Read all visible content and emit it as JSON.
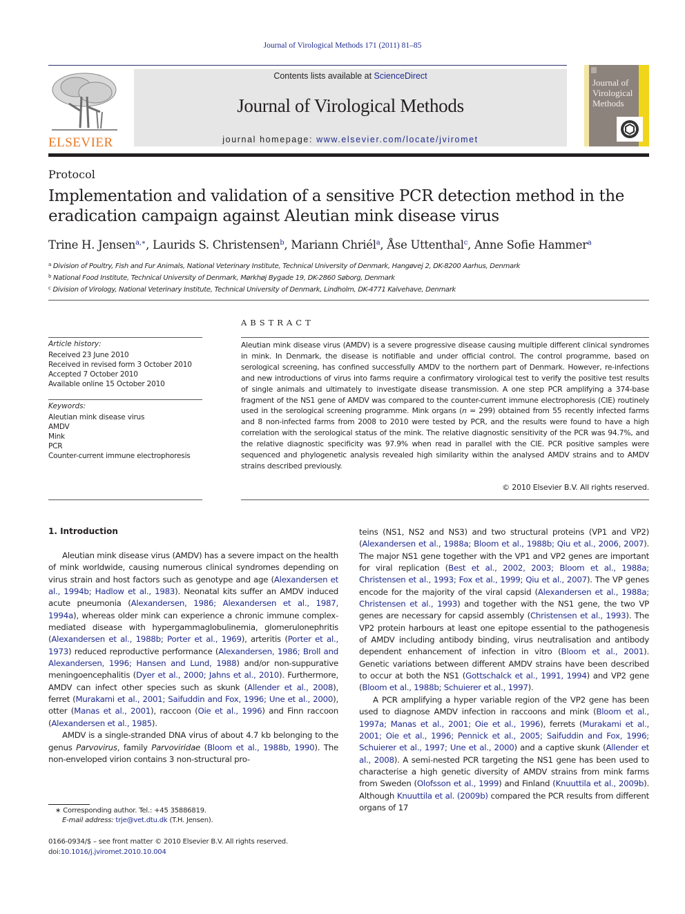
{
  "running_head": "Journal of Virological Methods 171 (2011) 81–85",
  "masthead": {
    "contents_prefix": "Contents lists available at ",
    "contents_link": "ScienceDirect",
    "journal_title": "Journal of Virological Methods",
    "homepage_prefix": "journal homepage: ",
    "homepage_link": "www.elsevier.com/locate/jviromet",
    "publisher_logo_text": "ELSEVIER",
    "cover_title": [
      "Journal of",
      "Virological",
      "Methods"
    ],
    "colors": {
      "publisher_orange": "#e87722",
      "link_blue": "#1f2b8e",
      "masthead_gray": "#e6e6e6",
      "cover_yellow": "#f1d51a"
    }
  },
  "article": {
    "section_type": "Protocol",
    "title": "Implementation and validation of a sensitive PCR detection method in the eradication campaign against Aleutian mink disease virus",
    "authors": [
      {
        "name": "Trine H. Jensen",
        "sup": "a,∗"
      },
      {
        "name": "Laurids S. Christensen",
        "sup": "b"
      },
      {
        "name": "Mariann Chriél",
        "sup": "a"
      },
      {
        "name": "Åse Uttenthal",
        "sup": "c"
      },
      {
        "name": "Anne Sofie Hammer",
        "sup": "a"
      }
    ],
    "affiliations": [
      {
        "key": "a",
        "text": "Division of Poultry, Fish and Fur Animals, National Veterinary Institute, Technical University of Denmark, Hangøvej 2, DK-8200 Aarhus, Denmark"
      },
      {
        "key": "b",
        "text": "National Food Institute, Technical University of Denmark, Mørkhøj Bygade 19, DK-2860 Søborg, Denmark"
      },
      {
        "key": "c",
        "text": "Division of Virology, National Veterinary Institute, Technical University of Denmark, Lindholm, DK-4771 Kalvehave, Denmark"
      }
    ]
  },
  "article_info": {
    "history_label": "Article history:",
    "history": [
      "Received 23 June 2010",
      "Received in revised form 3 October 2010",
      "Accepted 7 October 2010",
      "Available online 15 October 2010"
    ],
    "keywords_label": "Keywords:",
    "keywords": [
      "Aleutian mink disease virus",
      "AMDV",
      "Mink",
      "PCR",
      "Counter-current immune electrophoresis"
    ]
  },
  "abstract": {
    "heading": "ABSTRACT",
    "segments": [
      {
        "t": "Aleutian mink disease virus (AMDV) is a severe progressive disease causing multiple different clinical syndromes in mink. In Denmark, the disease is notifiable and under official control. The control programme, based on serological screening, has confined successfully AMDV to the northern part of Denmark. However, re-infections and new introductions of virus into farms require a confirmatory virological test to verify the positive test results of single animals and ultimately to investigate disease transmission. A one step PCR amplifying a 374-base fragment of the NS1 gene of AMDV was compared to the counter-current immune electrophoresis (CIE) routinely used in the serological screening programme. Mink organs ("
      },
      {
        "t": "n",
        "i": true
      },
      {
        "t": " = 299) obtained from 55 recently infected farms and 8 non-infected farms from 2008 to 2010 were tested by PCR, and the results were found to have a high correlation with the serological status of the mink. The relative diagnostic sensitivity of the PCR was 94.7%, and the relative diagnostic specificity was 97.9% when read in parallel with the CIE. PCR positive samples were sequenced and phylogenetic analysis revealed high similarity within the analysed AMDV strains and to AMDV strains described previously."
      }
    ],
    "copyright": "© 2010 Elsevier B.V. All rights reserved."
  },
  "introduction": {
    "heading": "1.  Introduction",
    "left_paragraphs": [
      [
        {
          "t": "Aleutian mink disease virus (AMDV) has a severe impact on the health of mink worldwide, causing numerous clinical syndromes depending on virus strain and host factors such as genotype and age ("
        },
        {
          "t": "Alexandersen et al., 1994b; Hadlow et al., 1983",
          "link": true
        },
        {
          "t": "). Neonatal kits suffer an AMDV induced acute pneumonia ("
        },
        {
          "t": "Alexandersen, 1986; Alexandersen et al., 1987, 1994a",
          "link": true
        },
        {
          "t": "), whereas older mink can experience a chronic immune complex-mediated disease with hypergammaglobulinemia, glomerulonephritis ("
        },
        {
          "t": "Alexandersen et al., 1988b; Porter et al., 1969",
          "link": true
        },
        {
          "t": "), arteritis ("
        },
        {
          "t": "Porter et al., 1973",
          "link": true
        },
        {
          "t": ") reduced reproductive performance ("
        },
        {
          "t": "Alexandersen, 1986; Broll and Alexandersen, 1996; Hansen and Lund, 1988",
          "link": true
        },
        {
          "t": ") and/or non-suppurative meningoencephalitis ("
        },
        {
          "t": "Dyer et al., 2000; Jahns et al., 2010",
          "link": true
        },
        {
          "t": "). Furthermore, AMDV can infect other species such as skunk ("
        },
        {
          "t": "Allender et al., 2008",
          "link": true
        },
        {
          "t": "), ferret ("
        },
        {
          "t": "Murakami et al., 2001; Saifuddin and Fox, 1996; Une et al., 2000",
          "link": true
        },
        {
          "t": "), otter ("
        },
        {
          "t": "Manas et al., 2001",
          "link": true
        },
        {
          "t": "), raccoon ("
        },
        {
          "t": "Oie et al., 1996",
          "link": true
        },
        {
          "t": ") and Finn raccoon ("
        },
        {
          "t": "Alexandersen et al., 1985",
          "link": true
        },
        {
          "t": ")."
        }
      ],
      [
        {
          "t": "AMDV is a single-stranded DNA virus of about 4.7 kb belonging to the genus "
        },
        {
          "t": "Parvovirus",
          "i": true
        },
        {
          "t": ", family "
        },
        {
          "t": "Parvoviridae",
          "i": true
        },
        {
          "t": " ("
        },
        {
          "t": "Bloom et al., 1988b, 1990",
          "link": true
        },
        {
          "t": "). The non-enveloped virion contains 3 non-structural pro-"
        }
      ]
    ],
    "right_paragraphs": [
      [
        {
          "t": "teins (NS1, NS2 and NS3) and two structural proteins (VP1 and VP2) ("
        },
        {
          "t": "Alexandersen et al., 1988a; Bloom et al., 1988b; Qiu et al., 2006, 2007",
          "link": true
        },
        {
          "t": "). The major NS1 gene together with the VP1 and VP2 genes are important for viral replication ("
        },
        {
          "t": "Best et al., 2002, 2003; Bloom et al., 1988a; Christensen et al., 1993; Fox et al., 1999; Qiu et al., 2007",
          "link": true
        },
        {
          "t": "). The VP genes encode for the majority of the viral capsid ("
        },
        {
          "t": "Alexandersen et al., 1988a; Christensen et al., 1993",
          "link": true
        },
        {
          "t": ") and together with the NS1 gene, the two VP genes are necessary for capsid assembly ("
        },
        {
          "t": "Christensen et al., 1993",
          "link": true
        },
        {
          "t": "). The VP2 protein harbours at least one epitope essential to the pathogenesis of AMDV including antibody binding, virus neutralisation and antibody dependent enhancement of infection in vitro ("
        },
        {
          "t": "Bloom et al., 2001",
          "link": true
        },
        {
          "t": "). Genetic variations between different AMDV strains have been described to occur at both the NS1 ("
        },
        {
          "t": "Gottschalck et al., 1991, 1994",
          "link": true
        },
        {
          "t": ") and VP2 gene ("
        },
        {
          "t": "Bloom et al., 1988b; Schuierer et al., 1997",
          "link": true
        },
        {
          "t": ")."
        }
      ],
      [
        {
          "t": "A PCR amplifying a hyper variable region of the VP2 gene has been used to diagnose AMDV infection in raccoons and mink ("
        },
        {
          "t": "Bloom et al., 1997a; Manas et al., 2001; Oie et al., 1996",
          "link": true
        },
        {
          "t": "), ferrets ("
        },
        {
          "t": "Murakami et al., 2001; Oie et al., 1996; Pennick et al., 2005; Saifuddin and Fox, 1996; Schuierer et al., 1997; Une et al., 2000",
          "link": true
        },
        {
          "t": ") and a captive skunk ("
        },
        {
          "t": "Allender et al., 2008",
          "link": true
        },
        {
          "t": "). A semi-nested PCR targeting the NS1 gene has been used to characterise a high genetic diversity of AMDV strains from mink farms from Sweden ("
        },
        {
          "t": "Olofsson et al., 1999",
          "link": true
        },
        {
          "t": ") and Finland ("
        },
        {
          "t": "Knuuttila et al., 2009b",
          "link": true
        },
        {
          "t": "). Although "
        },
        {
          "t": "Knuuttila et al. (2009b)",
          "link": true
        },
        {
          "t": " compared the PCR results from different organs of 17"
        }
      ]
    ]
  },
  "footnote": {
    "marker": "∗",
    "corresponding": "Corresponding author. Tel.: +45 35886819.",
    "email_label": "E-mail address:",
    "email": "trje@vet.dtu.dk",
    "email_suffix": " (T.H. Jensen)."
  },
  "bottom_meta": {
    "issn_line": "0166-0934/$ – see front matter © 2010 Elsevier B.V. All rights reserved.",
    "doi_prefix": "doi:",
    "doi": "10.1016/j.jviromet.2010.10.004"
  }
}
